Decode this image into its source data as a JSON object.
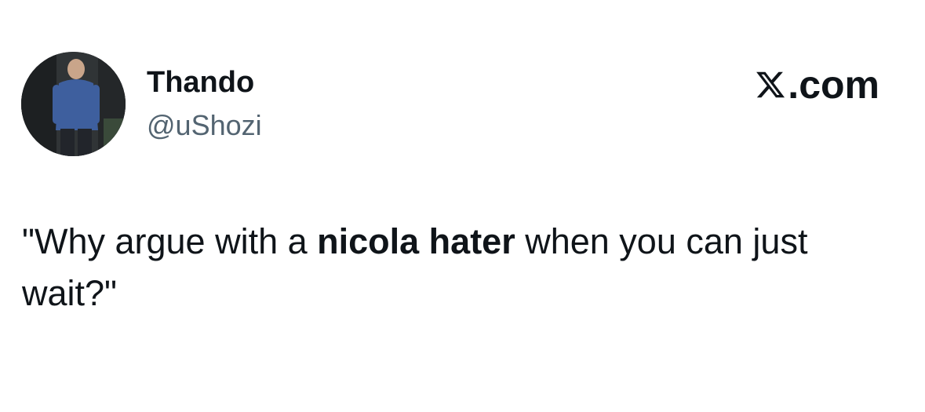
{
  "author": {
    "display_name": "Thando",
    "handle": "@uShozi",
    "avatar_icon": "person-avatar"
  },
  "platform": {
    "icon": "x-logo-icon",
    "label": ".com"
  },
  "tweet": {
    "text_before": "\"Why argue with a ",
    "text_bold": "nicola hater",
    "text_after": " when you can just wait?\""
  },
  "colors": {
    "text_primary": "#0f1419",
    "text_secondary": "#536471",
    "background": "#ffffff"
  }
}
